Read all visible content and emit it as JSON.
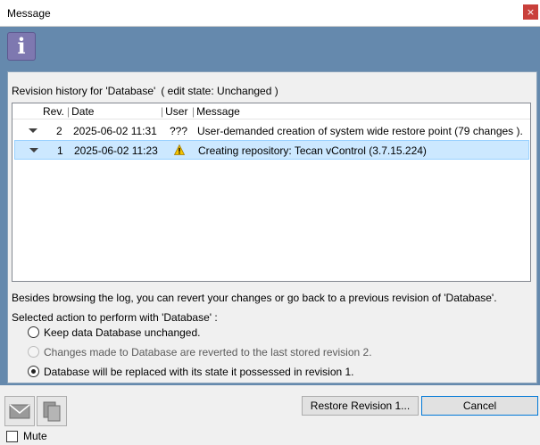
{
  "window": {
    "title": "Message",
    "close_glyph": "×"
  },
  "banner": {
    "icon": "info-icon",
    "icon_glyph": "i",
    "icon_color": "#7e78b0"
  },
  "revision_history": {
    "caption": "Revision history for 'Database'",
    "edit_state": "( edit state: Unchanged )",
    "columns": [
      "Rev.",
      "Date",
      "User",
      "Message"
    ],
    "rows": [
      {
        "rev": "2",
        "date": "2025-06-02 11:31",
        "user": "???",
        "message": "User-demanded creation of system wide restore point (79 changes ).",
        "selected": false
      },
      {
        "rev": "1",
        "date": "2025-06-02 11:23",
        "user": "",
        "user_icon": "warning-icon",
        "message": "Creating repository: Tecan vControl (3.7.15.224)",
        "selected": true
      }
    ]
  },
  "description": "Besides browsing the log, you can revert your changes or go back to a previous revision of 'Database'.",
  "action": {
    "caption": "Selected action to perform with 'Database' :",
    "options": [
      {
        "label": "Keep data Database unchanged.",
        "checked": false,
        "enabled": true
      },
      {
        "label": "Changes made to Database are reverted to the last stored revision 2.",
        "checked": false,
        "enabled": false
      },
      {
        "label": "Database will be replaced with its state it possessed in revision 1.",
        "checked": true,
        "enabled": true
      }
    ]
  },
  "footer": {
    "email_icon": "envelope-icon",
    "copy_icon": "copy-icon",
    "restore_label": "Restore Revision 1...",
    "cancel_label": "Cancel",
    "mute_label": "Mute",
    "mute_checked": false
  },
  "colors": {
    "frame": "#6589ad",
    "selection": "#cce8ff",
    "close_button": "#c9403b",
    "default_button_border": "#0078d7"
  }
}
